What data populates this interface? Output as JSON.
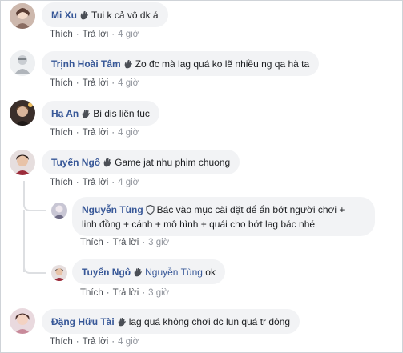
{
  "comments": [
    {
      "name": "Mi Xu",
      "text": "Tui k cả vô dk á",
      "like": "Thích",
      "reply": "Trả lời",
      "time": "4 giờ"
    },
    {
      "name": "Trịnh Hoài Tâm",
      "text": "Zo đc mà lag quá ko lẽ nhiều ng qa hà ta",
      "like": "Thích",
      "reply": "Trả lời",
      "time": "4 giờ"
    },
    {
      "name": "Hạ An",
      "text": "Bị dis liên tục",
      "like": "Thích",
      "reply": "Trả lời",
      "time": "4 giờ"
    },
    {
      "name": "Tuyển Ngô",
      "text": "Game jat nhu phim chuong",
      "like": "Thích",
      "reply": "Trả lời",
      "time": "4 giờ"
    },
    {
      "name": "Nguyễn Tùng",
      "text_line1": "Bác vào mục cài đặt để ẩn bớt người chơi +",
      "text_line2": "linh đồng + cánh + mô hình + quái cho bớt lag bác nhé",
      "like": "Thích",
      "reply": "Trả lời",
      "time": "3 giờ"
    },
    {
      "name": "Tuyển Ngô",
      "mention": "Nguyễn Tùng",
      "text": "ok",
      "like": "Thích",
      "reply": "Trả lời",
      "time": "3 giờ"
    },
    {
      "name": "Đặng Hữu Tài",
      "text": "lag quá không chơi đc lun quá tr đông",
      "like": "Thích",
      "reply": "Trả lời",
      "time": "4 giờ"
    }
  ],
  "icons": {
    "wave": "wave-hand-icon",
    "shield": "shield-icon"
  },
  "colors": {
    "name": "#385898",
    "bubble": "#f2f3f5",
    "meta": "#606770"
  }
}
